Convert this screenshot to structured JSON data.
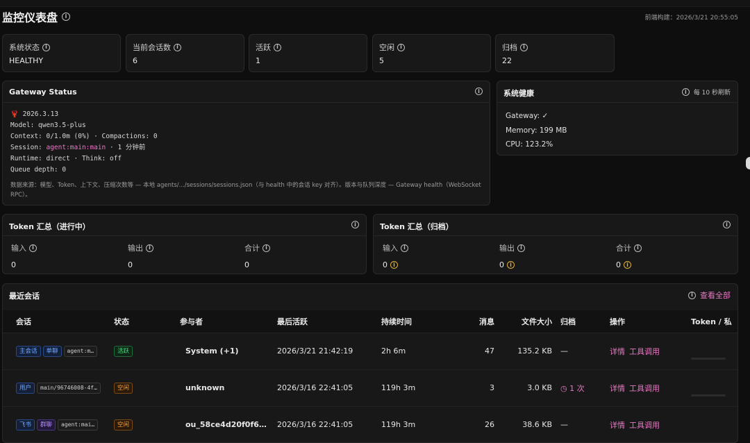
{
  "header": {
    "title": "监控仪表盘",
    "build": "前端构建：2026/3/21 20:55:05"
  },
  "stats": [
    {
      "label": "系统状态",
      "value": "HEALTHY"
    },
    {
      "label": "当前会话数",
      "value": "6"
    },
    {
      "label": "活跃",
      "value": "1"
    },
    {
      "label": "空闲",
      "value": "5"
    },
    {
      "label": "归档",
      "value": "22"
    }
  ],
  "gateway": {
    "title": "Gateway Status",
    "version": "2026.3.13",
    "model": "Model: qwen3.5-plus",
    "context": "Context: 0/1.0m (0%) · Compactions: 0",
    "session_prefix": "Session: ",
    "session_id": "agent:main:main",
    "session_suffix": " · 1 分钟前",
    "runtime": "Runtime: direct · Think: off",
    "queue": "Queue depth: 0",
    "source": "数据来源：模型、Token、上下文、压缩次数等 — 本地 agents/.../sessions/sessions.json（与 health 中的会话 key 对齐）。版本与队列深度 — Gateway health（WebSocket RPC）。"
  },
  "health": {
    "title": "系统健康",
    "refresh": "每 10 秒刷新",
    "gateway": "Gateway: ✓",
    "memory": "Memory: 199 MB",
    "cpu": "CPU: 123.2%"
  },
  "token_active": {
    "title": "Token 汇总（进行中）",
    "cols": [
      {
        "label": "输入",
        "value": "0"
      },
      {
        "label": "输出",
        "value": "0"
      },
      {
        "label": "合计",
        "value": "0"
      }
    ]
  },
  "token_archived": {
    "title": "Token 汇总（归档）",
    "cols": [
      {
        "label": "输入",
        "value": "0"
      },
      {
        "label": "输出",
        "value": "0"
      },
      {
        "label": "合计",
        "value": "0"
      }
    ]
  },
  "recent": {
    "title": "最近会话",
    "view_all": "查看全部",
    "columns": [
      "会话",
      "状态",
      "参与者",
      "最后活跃",
      "持续时间",
      "消息",
      "文件大小",
      "归档",
      "操作",
      "Token / 私"
    ],
    "rows": [
      {
        "tags": [
          "主会话",
          "单聊"
        ],
        "code": "agent:m…",
        "status": "活跃",
        "participant": "System (+1)",
        "last": "2026/3/21 21:42:19",
        "duration": "2h 6m",
        "messages": "47",
        "size": "135.2 KB",
        "archive": "—",
        "detail": "详情",
        "tools": "工具调用"
      },
      {
        "tags": [
          "用户"
        ],
        "code": "main/96746008-4f…",
        "status": "空闲",
        "participant": "unknown",
        "last": "2026/3/16 22:41:05",
        "duration": "119h 3m",
        "messages": "3",
        "size": "3.0 KB",
        "archive": "1 次",
        "detail": "详情",
        "tools": "工具调用"
      },
      {
        "tags": [
          "飞书",
          "群聊"
        ],
        "code": "agent:mai…",
        "status": "空闲",
        "participant": "ou_58ce4d20f0f6…",
        "last": "2026/3/16 22:41:05",
        "duration": "119h 3m",
        "messages": "26",
        "size": "38.6 KB",
        "archive": "—",
        "detail": "详情",
        "tools": "工具调用"
      }
    ]
  }
}
